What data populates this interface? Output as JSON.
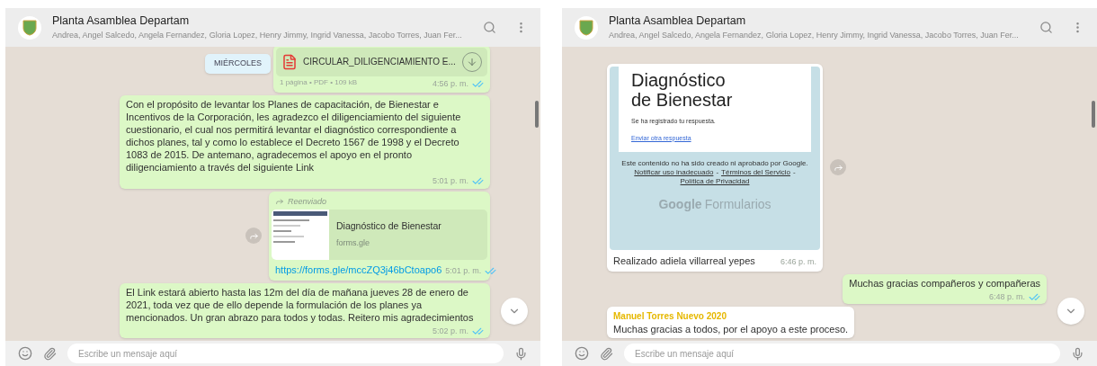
{
  "panels": [
    {
      "header": {
        "title": "Planta Asamblea Departam",
        "subtitle": "Andrea, Angel Salcedo, Angela Fernandez, Gloria Lopez, Henry Jimmy, Ingrid Vanessa, Jacobo Torres, Juan Fer..."
      },
      "date_chip": "MIÉRCOLES",
      "messages": [
        {
          "kind": "document",
          "outgoing": true,
          "forward_button": false,
          "file_name": "CIRCULAR_DILIGENCIAMIENTO E...",
          "meta": "1 página • PDF • 109 kB",
          "time": "4:56 p. m.",
          "read": true
        },
        {
          "kind": "text",
          "outgoing": true,
          "forward_button": false,
          "text": "Con el propósito de levantar los Planes de capacitación, de Bienestar e Incentivos de la Corporación, les agradezco el diligenciamiento del siguiente cuestionario, el cual nos permitirá levantar el diagnóstico correspondiente a dichos planes, tal y como lo establece el Decreto 1567 de 1998 y el Decreto 1083 de 2015. De antemano, agradecemos el apoyo en el pronto diligenciamiento a través del siguiente Link",
          "time": "5:01 p. m.",
          "read": true
        },
        {
          "kind": "link",
          "outgoing": true,
          "forward_button": true,
          "forwarded_label": "Reenviado",
          "preview_title": "Diagnóstico de Bienestar",
          "preview_domain": "forms.gle",
          "url": "https://forms.gle/mccZQ3j46bCtoapo6",
          "time": "5:01 p. m.",
          "read": true
        },
        {
          "kind": "text",
          "outgoing": true,
          "forward_button": false,
          "text": "El Link estará abierto hasta las 12m del día de mañana jueves 28 de enero de 2021, toda vez que de ello depende la formulación de los planes ya mencionados. Un gran abrazo para todos y todas. Reitero mis agradecimientos",
          "time": "5:02 p. m.",
          "read": true
        }
      ],
      "composer": {
        "placeholder": "Escribe un mensaje aquí"
      }
    },
    {
      "header": {
        "title": "Planta Asamblea Departam",
        "subtitle": "Andrea, Angel Salcedo, Angela Fernandez, Gloria Lopez, Henry Jimmy, Ingrid Vanessa, Jacobo Torres, Juan Fer..."
      },
      "messages": [
        {
          "kind": "form_image",
          "outgoing": false,
          "forward_button": true,
          "form_title": "Diagnóstico de Bienestar",
          "confirmation": "Se ha registrado tu respuesta.",
          "resend_link": "Enviar otra respuesta",
          "disclaimer": "Este contenido no ha sido creado ni aprobado por Google.",
          "footer_links": [
            "Notificar uso inadecuado",
            "Términos del Servicio",
            "Política de Privacidad"
          ],
          "link_separator": "-",
          "logo_brand": "Google",
          "logo_product": "Formularios",
          "caption": "Realizado adiela villarreal yepes",
          "time": "6:46 p. m."
        },
        {
          "kind": "text",
          "outgoing": true,
          "forward_button": false,
          "text": "Muchas gracias compañeros y compañeras",
          "time": "6:48 p. m.",
          "read": true
        },
        {
          "kind": "text",
          "outgoing": false,
          "forward_button": false,
          "author": "Manuel Torres Nuevo 2020",
          "text": "Muchas gracias a todos, por el apoyo a este proceso."
        }
      ],
      "composer": {
        "placeholder": "Escribe un mensaje aquí"
      }
    }
  ]
}
